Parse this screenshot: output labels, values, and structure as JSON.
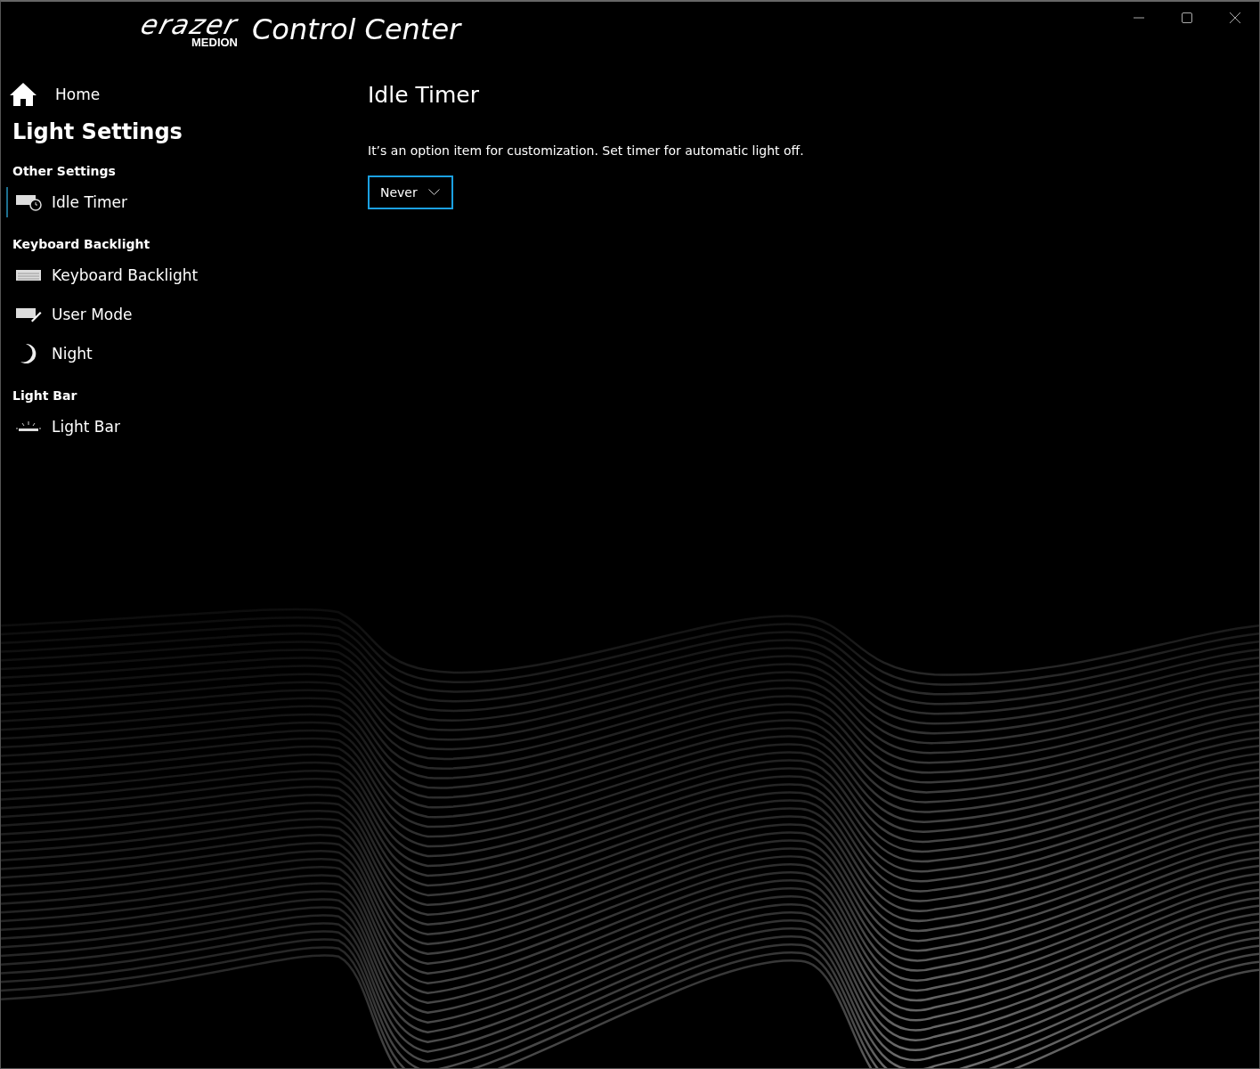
{
  "logo": {
    "brand": "erazer",
    "maker": "MEDION"
  },
  "window": {
    "title": "Control Center"
  },
  "sidebar": {
    "home": "Home",
    "title": "Light Settings",
    "sections": [
      {
        "heading": "Other Settings",
        "items": [
          {
            "label": "Idle Timer",
            "kind": "timer",
            "selected": true
          }
        ]
      },
      {
        "heading": "Keyboard Backlight",
        "items": [
          {
            "label": "Keyboard Backlight",
            "kind": "keyboard",
            "selected": false
          },
          {
            "label": "User Mode",
            "kind": "pen",
            "selected": false
          },
          {
            "label": "Night",
            "kind": "moon",
            "selected": false
          }
        ]
      },
      {
        "heading": "Light Bar",
        "items": [
          {
            "label": "Light Bar",
            "kind": "lightbar",
            "selected": false
          }
        ]
      }
    ]
  },
  "content": {
    "title": "Idle Timer",
    "description": "It’s an option item for customization. Set timer for automatic light off.",
    "dropdown": {
      "value": "Never"
    }
  }
}
